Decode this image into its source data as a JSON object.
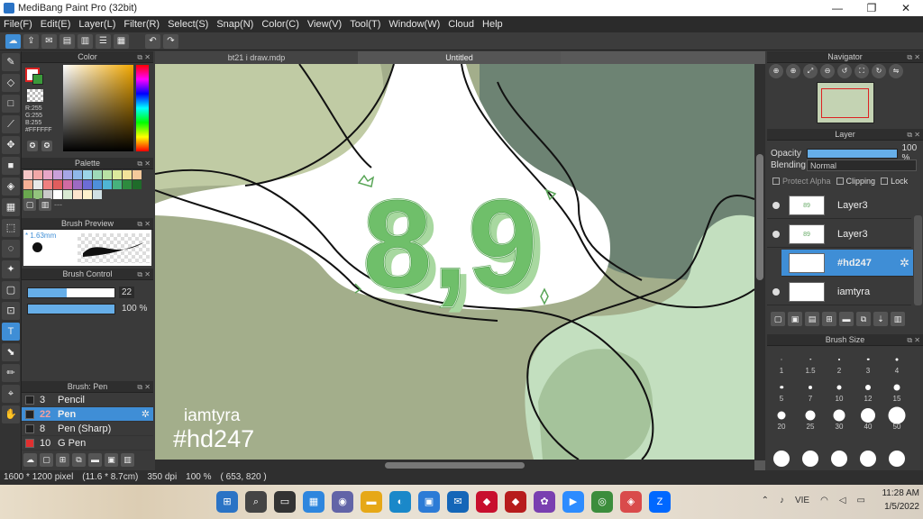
{
  "window": {
    "title": "MediBang Paint Pro (32bit)",
    "controls": [
      "—",
      "❐",
      "✕"
    ]
  },
  "menu": [
    "File(F)",
    "Edit(E)",
    "Layer(L)",
    "Filter(R)",
    "Select(S)",
    "Snap(N)",
    "Color(C)",
    "View(V)",
    "Tool(T)",
    "Window(W)",
    "Cloud",
    "Help"
  ],
  "toolbar": {
    "icons": [
      "cloud-icon",
      "share-icon",
      "comment-icon",
      "page-icon",
      "document-icon",
      "list-icon",
      "grid-icon"
    ],
    "undo_glyph": "↶",
    "redo_glyph": "↷"
  },
  "tools": [
    "✎",
    "◇",
    "□",
    "⟋",
    "✥",
    "■",
    "◈",
    "▦",
    "⬚",
    "◌",
    "✦",
    "▢",
    "⊡",
    "T",
    "⬊",
    "✏",
    "⌖",
    "✋"
  ],
  "color_panel": {
    "title": "Color",
    "fg_color": "#FFFFFF",
    "bg_color": "#3A9A3A",
    "rgb": [
      "R:255",
      "G:255",
      "B:255",
      "#FFFFFF"
    ]
  },
  "palette": {
    "title": "Palette",
    "swatches": [
      "#f5c6c6",
      "#f2a7a7",
      "#e7a6c7",
      "#c9a0d9",
      "#a6a6e6",
      "#8fb8e9",
      "#9bd5e6",
      "#9ed9b7",
      "#b8e0a4",
      "#dce89c",
      "#f3e29a",
      "#f5c99b",
      "#f6b095",
      "#e8e8e8",
      "#f08080",
      "#e05d5d",
      "#d16aa3",
      "#9c6ac2",
      "#6c6cd6",
      "#4e8fdb",
      "#4fb5d4",
      "#47b27d",
      "#2e8b3e",
      "#1f6b2a",
      "#6aa84f",
      "#93c47d",
      "#c9c9c9",
      "#ffffff",
      "#d9ead3",
      "#fce5cd",
      "#fff2cc",
      "#d0e0e3"
    ],
    "empty_label": "---"
  },
  "brush_preview": {
    "title": "Brush Preview",
    "size_label": "* 1.63mm"
  },
  "brush_control": {
    "title": "Brush Control",
    "size_value": "22",
    "size_fraction": 0.45,
    "opacity_value": "100 %",
    "opacity_fraction": 1.0
  },
  "brush_list": {
    "title": "Brush: Pen",
    "items": [
      {
        "num": "3",
        "name": "Pencil",
        "color": "#222222"
      },
      {
        "num": "22",
        "name": "Pen",
        "color": "#222222"
      },
      {
        "num": "8",
        "name": "Pen (Sharp)",
        "color": "#222222"
      },
      {
        "num": "10",
        "name": "G Pen",
        "color": "#e03030"
      }
    ],
    "selected_index": 1
  },
  "canvas": {
    "tabs": [
      "bt21 i draw.mdp",
      "Untitled"
    ],
    "active_tab": 1,
    "art_text": "8,9",
    "watermark_name": "iamtyra",
    "watermark_tag": "#hd247"
  },
  "navigator": {
    "title": "Navigator",
    "icons": [
      "zoom-in-icon",
      "zoom-in-2-icon",
      "fit-icon",
      "zoom-out-icon",
      "rotate-left-icon",
      "fullscreen-icon",
      "rotate-right-icon",
      "flip-icon"
    ]
  },
  "layer_panel": {
    "title": "Layer",
    "opacity_label": "Opacity",
    "opacity_value": "100 %",
    "blending_label": "Blending",
    "blending_value": "Normal",
    "protect_alpha": "Protect Alpha",
    "clipping": "Clipping",
    "lock": "Lock",
    "layers": [
      {
        "name": "Layer3",
        "thumb": "89"
      },
      {
        "name": "Layer3",
        "thumb": "89"
      },
      {
        "name": "#hd247",
        "thumb": ""
      },
      {
        "name": "iamtyra",
        "thumb": ""
      }
    ],
    "selected_index": 2
  },
  "brush_size": {
    "title": "Brush Size",
    "sizes": [
      {
        "label": "1",
        "d": 1
      },
      {
        "label": "1.5",
        "d": 1.5
      },
      {
        "label": "2",
        "d": 2
      },
      {
        "label": "3",
        "d": 2.5
      },
      {
        "label": "4",
        "d": 3
      },
      {
        "label": "5",
        "d": 3.5
      },
      {
        "label": "7",
        "d": 4
      },
      {
        "label": "10",
        "d": 5
      },
      {
        "label": "12",
        "d": 6
      },
      {
        "label": "15",
        "d": 7
      },
      {
        "label": "20",
        "d": 9
      },
      {
        "label": "25",
        "d": 11
      },
      {
        "label": "30",
        "d": 13
      },
      {
        "label": "40",
        "d": 16
      },
      {
        "label": "50",
        "d": 19
      },
      {
        "label": "",
        "d": 18
      },
      {
        "label": "",
        "d": 18
      },
      {
        "label": "",
        "d": 18
      },
      {
        "label": "",
        "d": 18
      },
      {
        "label": "",
        "d": 18
      }
    ]
  },
  "status": {
    "size": "1600 * 1200 pixel",
    "physical": "(11.6 * 8.7cm)",
    "dpi": "350 dpi",
    "zoom": "100 %",
    "coords": "( 653, 820 )"
  },
  "taskbar": {
    "apps": [
      {
        "name": "start-icon",
        "glyph": "⊞",
        "color": "#2a73c5"
      },
      {
        "name": "search-icon",
        "glyph": "⌕",
        "color": "#444444"
      },
      {
        "name": "task-view-icon",
        "glyph": "▭",
        "color": "#333333"
      },
      {
        "name": "widgets-icon",
        "glyph": "▦",
        "color": "#2e86de"
      },
      {
        "name": "teams-icon",
        "glyph": "◉",
        "color": "#6264a7"
      },
      {
        "name": "explorer-icon",
        "glyph": "▬",
        "color": "#e6a817"
      },
      {
        "name": "edge-icon",
        "glyph": "◐",
        "color": "#1a88c9"
      },
      {
        "name": "store-icon",
        "glyph": "▣",
        "color": "#2c7bd6"
      },
      {
        "name": "outlook-icon",
        "glyph": "✉",
        "color": "#1466b8"
      },
      {
        "name": "antivirus-icon",
        "glyph": "◆",
        "color": "#c8102e"
      },
      {
        "name": "app-icon",
        "glyph": "◆",
        "color": "#b71c1c"
      },
      {
        "name": "app2-icon",
        "glyph": "✿",
        "color": "#7a3fb0"
      },
      {
        "name": "zoom-icon",
        "glyph": "▶",
        "color": "#2d8cff"
      },
      {
        "name": "chrome-icon",
        "glyph": "◎",
        "color": "#3c8d3c"
      },
      {
        "name": "medibang-icon",
        "glyph": "◈",
        "color": "#d94b4b"
      },
      {
        "name": "zalo-icon",
        "glyph": "Z",
        "color": "#0068ff"
      }
    ],
    "lang": "VIE",
    "time": "11:28 AM",
    "date": "1/5/2022"
  }
}
